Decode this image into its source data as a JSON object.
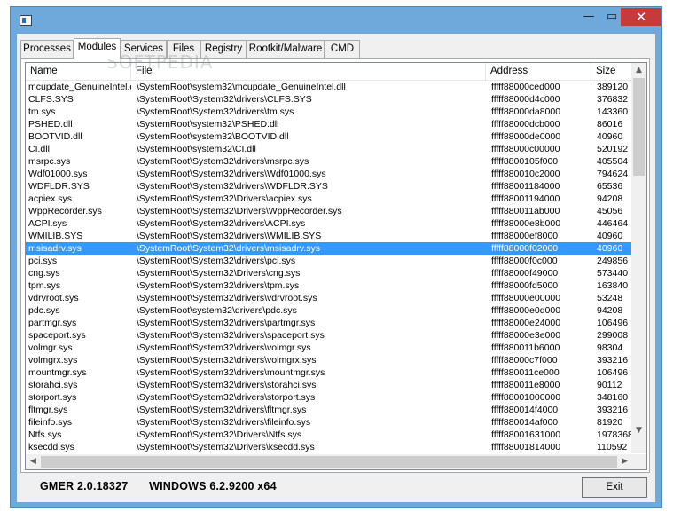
{
  "window": {
    "title": "",
    "minimize_glyph": "—",
    "maximize_glyph": "▭",
    "close_glyph": "✕"
  },
  "tabs": [
    {
      "label": "Processes",
      "active": false
    },
    {
      "label": "Modules",
      "active": true
    },
    {
      "label": "Services",
      "active": false
    },
    {
      "label": "Files",
      "active": false
    },
    {
      "label": "Registry",
      "active": false
    },
    {
      "label": "Rootkit/Malware",
      "active": false
    },
    {
      "label": "CMD",
      "active": false
    }
  ],
  "columns": {
    "name": "Name",
    "file": "File",
    "address": "Address",
    "size": "Size"
  },
  "rows": [
    {
      "name": "mcupdate_GenuineIntel.dll",
      "file": "\\SystemRoot\\system32\\mcupdate_GenuineIntel.dll",
      "address": "fffff88000ced000",
      "size": "389120"
    },
    {
      "name": "CLFS.SYS",
      "file": "\\SystemRoot\\System32\\drivers\\CLFS.SYS",
      "address": "fffff88000d4c000",
      "size": "376832"
    },
    {
      "name": "tm.sys",
      "file": "\\SystemRoot\\System32\\drivers\\tm.sys",
      "address": "fffff88000da8000",
      "size": "143360"
    },
    {
      "name": "PSHED.dll",
      "file": "\\SystemRoot\\system32\\PSHED.dll",
      "address": "fffff88000dcb000",
      "size": "86016"
    },
    {
      "name": "BOOTVID.dll",
      "file": "\\SystemRoot\\system32\\BOOTVID.dll",
      "address": "fffff88000de0000",
      "size": "40960"
    },
    {
      "name": "CI.dll",
      "file": "\\SystemRoot\\system32\\CI.dll",
      "address": "fffff88000c00000",
      "size": "520192"
    },
    {
      "name": "msrpc.sys",
      "file": "\\SystemRoot\\System32\\drivers\\msrpc.sys",
      "address": "fffff8800105f000",
      "size": "405504"
    },
    {
      "name": "Wdf01000.sys",
      "file": "\\SystemRoot\\System32\\drivers\\Wdf01000.sys",
      "address": "fffff880010c2000",
      "size": "794624"
    },
    {
      "name": "WDFLDR.SYS",
      "file": "\\SystemRoot\\System32\\drivers\\WDFLDR.SYS",
      "address": "fffff88001184000",
      "size": "65536"
    },
    {
      "name": "acpiex.sys",
      "file": "\\SystemRoot\\System32\\Drivers\\acpiex.sys",
      "address": "fffff88001194000",
      "size": "94208"
    },
    {
      "name": "WppRecorder.sys",
      "file": "\\SystemRoot\\System32\\Drivers\\WppRecorder.sys",
      "address": "fffff880011ab000",
      "size": "45056"
    },
    {
      "name": "ACPI.sys",
      "file": "\\SystemRoot\\System32\\drivers\\ACPI.sys",
      "address": "fffff88000e8b000",
      "size": "446464"
    },
    {
      "name": "WMILIB.SYS",
      "file": "\\SystemRoot\\System32\\drivers\\WMILIB.SYS",
      "address": "fffff88000ef8000",
      "size": "40960"
    },
    {
      "name": "msisadrv.sys",
      "file": "\\SystemRoot\\System32\\drivers\\msisadrv.sys",
      "address": "fffff88000f02000",
      "size": "40960",
      "selected": true
    },
    {
      "name": "pci.sys",
      "file": "\\SystemRoot\\System32\\drivers\\pci.sys",
      "address": "fffff88000f0c000",
      "size": "249856"
    },
    {
      "name": "cng.sys",
      "file": "\\SystemRoot\\System32\\Drivers\\cng.sys",
      "address": "fffff88000f49000",
      "size": "573440"
    },
    {
      "name": "tpm.sys",
      "file": "\\SystemRoot\\System32\\drivers\\tpm.sys",
      "address": "fffff88000fd5000",
      "size": "163840"
    },
    {
      "name": "vdrvroot.sys",
      "file": "\\SystemRoot\\System32\\drivers\\vdrvroot.sys",
      "address": "fffff88000e00000",
      "size": "53248"
    },
    {
      "name": "pdc.sys",
      "file": "\\SystemRoot\\system32\\drivers\\pdc.sys",
      "address": "fffff88000e0d000",
      "size": "94208"
    },
    {
      "name": "partmgr.sys",
      "file": "\\SystemRoot\\System32\\drivers\\partmgr.sys",
      "address": "fffff88000e24000",
      "size": "106496"
    },
    {
      "name": "spaceport.sys",
      "file": "\\SystemRoot\\System32\\drivers\\spaceport.sys",
      "address": "fffff88000e3e000",
      "size": "299008"
    },
    {
      "name": "volmgr.sys",
      "file": "\\SystemRoot\\System32\\drivers\\volmgr.sys",
      "address": "fffff880011b6000",
      "size": "98304"
    },
    {
      "name": "volmgrx.sys",
      "file": "\\SystemRoot\\System32\\drivers\\volmgrx.sys",
      "address": "fffff88000c7f000",
      "size": "393216"
    },
    {
      "name": "mountmgr.sys",
      "file": "\\SystemRoot\\System32\\drivers\\mountmgr.sys",
      "address": "fffff880011ce000",
      "size": "106496"
    },
    {
      "name": "storahci.sys",
      "file": "\\SystemRoot\\System32\\drivers\\storahci.sys",
      "address": "fffff880011e8000",
      "size": "90112"
    },
    {
      "name": "storport.sys",
      "file": "\\SystemRoot\\System32\\drivers\\storport.sys",
      "address": "fffff88001000000",
      "size": "348160"
    },
    {
      "name": "fltmgr.sys",
      "file": "\\SystemRoot\\System32\\drivers\\fltmgr.sys",
      "address": "fffff880014f4000",
      "size": "393216"
    },
    {
      "name": "fileinfo.sys",
      "file": "\\SystemRoot\\System32\\drivers\\fileinfo.sys",
      "address": "fffff880014af000",
      "size": "81920"
    },
    {
      "name": "Ntfs.sys",
      "file": "\\SystemRoot\\System32\\Drivers\\Ntfs.sys",
      "address": "fffff88001631000",
      "size": "1978368"
    },
    {
      "name": "ksecdd.sys",
      "file": "\\SystemRoot\\System32\\Drivers\\ksecdd.sys",
      "address": "fffff88001814000",
      "size": "110592"
    }
  ],
  "status": {
    "version": "GMER 2.0.18327",
    "os": "WINDOWS 6.2.9200  x64"
  },
  "buttons": {
    "exit": "Exit"
  },
  "watermark": "SOFTPEDIA",
  "colors": {
    "titlebar": "#6fa9dc",
    "close": "#c7393a",
    "selection": "#3399ff"
  }
}
